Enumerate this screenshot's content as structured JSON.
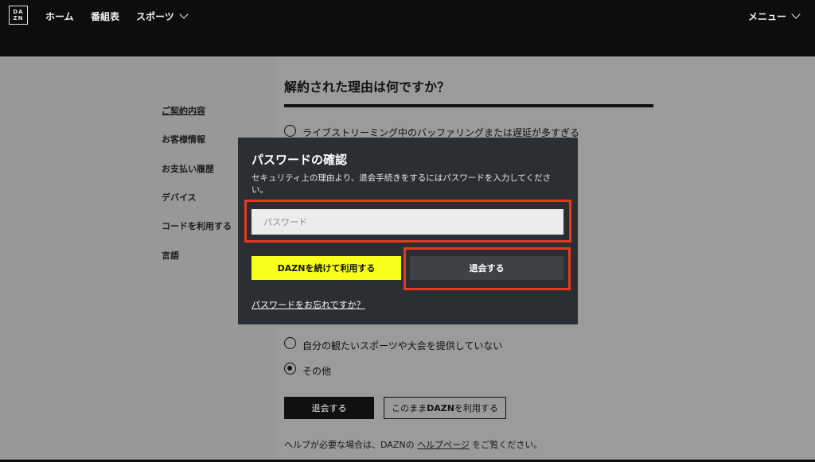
{
  "nav": {
    "logo_lines": [
      "DA",
      "ZN"
    ],
    "home": "ホーム",
    "schedule": "番組表",
    "sports": "スポーツ",
    "menu": "メニュー"
  },
  "sidebar": {
    "items": [
      {
        "label": "ご契約内容"
      },
      {
        "label": "お客様情報"
      },
      {
        "label": "お支払い履歴"
      },
      {
        "label": "デバイス"
      },
      {
        "label": "コードを利用する"
      },
      {
        "label": "言語"
      }
    ]
  },
  "survey": {
    "title": "解約された理由は何ですか？",
    "options": [
      {
        "label": "ライブストリーミング中のバッファリングまたは遅延が多すぎる",
        "checked": false
      },
      {
        "label": "自分の観たいスポーツや大会を提供していない",
        "checked": false
      },
      {
        "label": "その他",
        "checked": true
      }
    ],
    "cancel_button": "退会する",
    "continue_button_prefix": "このまま",
    "continue_button_brand": "DAZN",
    "continue_button_suffix": "を利用する",
    "help_prefix": "ヘルプが必要な場合は、DAZNの ",
    "help_link": "ヘルプページ",
    "help_suffix": " をご覧ください。"
  },
  "modal": {
    "title": "パスワードの確認",
    "description": "セキュリティ上の理由より、退会手続きをするにはパスワードを入力してください。",
    "password_placeholder": "パスワード",
    "continue_button": "DAZNを続けて利用する",
    "unsubscribe_button": "退会する",
    "forgot_link": "パスワードをお忘れですか？"
  },
  "colors": {
    "highlight": "#e63a1f",
    "accent_yellow": "#f7ff1a"
  }
}
